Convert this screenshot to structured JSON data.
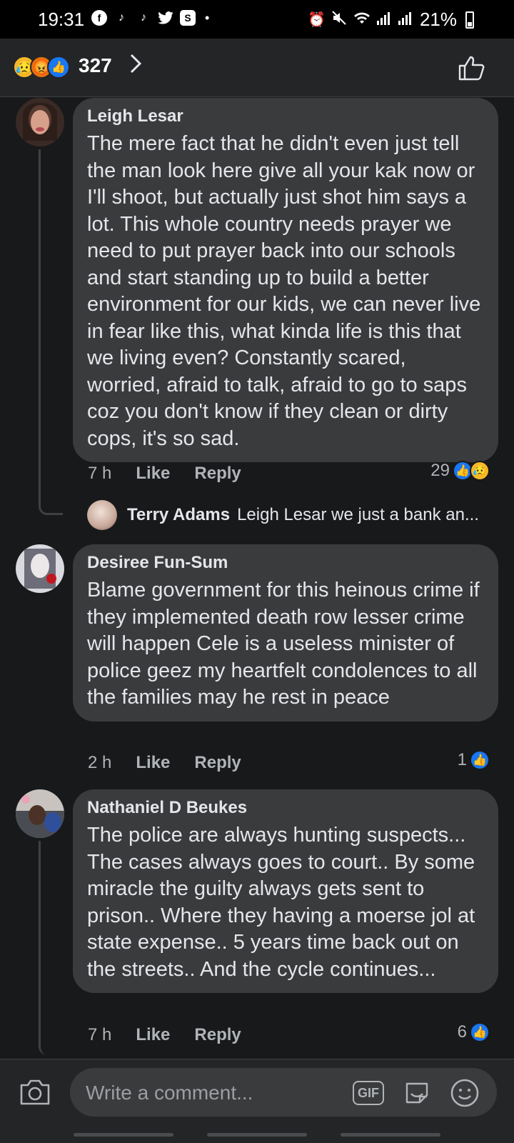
{
  "status_bar": {
    "time": "19:31",
    "battery": "21%",
    "apps": [
      "facebook-icon",
      "tiktok-icon",
      "tiktok-icon",
      "twitter-icon",
      "s-app-icon"
    ]
  },
  "header": {
    "reaction_count": "327",
    "reactions": [
      "sad",
      "angry",
      "like"
    ]
  },
  "comments": [
    {
      "author": "Leigh Lesar",
      "text": "The mere fact that he didn't even just tell the man look here give all your kak now or I'll shoot, but actually just shot him says a lot. This whole country needs prayer we need to put prayer back into our schools and start standing up to build a better environment for our kids, we can never live in fear like this, what kinda life is this that we living even? Constantly scared, worried, afraid to talk, afraid to go to saps coz you don't know if they clean or dirty cops, it's so sad.",
      "time": "7 h",
      "like_label": "Like",
      "reply_label": "Reply",
      "reaction_count": "29",
      "reply_preview": {
        "author": "Terry Adams",
        "text": "Leigh Lesar we just a bank an..."
      }
    },
    {
      "author": "Desiree Fun-Sum",
      "text": "Blame government for this heinous crime if they implemented death row lesser crime will happen Cele is a useless minister of police geez my heartfelt condolences to all the families may he rest in peace",
      "time": "2 h",
      "like_label": "Like",
      "reply_label": "Reply",
      "reaction_count": "1"
    },
    {
      "author": "Nathaniel D Beukes",
      "text": "The police are always hunting suspects... The cases always goes to court.. By some miracle the guilty always gets sent to prison.. Where they having a moerse jol at state expense.. 5 years time back out on the streets.. And the cycle continues...",
      "time": "7 h",
      "like_label": "Like",
      "reply_label": "Reply",
      "reaction_count": "6"
    }
  ],
  "composer": {
    "placeholder": "Write a comment...",
    "gif_label": "GIF"
  },
  "colors": {
    "background": "#18191a",
    "bubble": "#3a3b3c",
    "like_blue": "#1877f2",
    "secondary_text": "#b0b3b8"
  }
}
